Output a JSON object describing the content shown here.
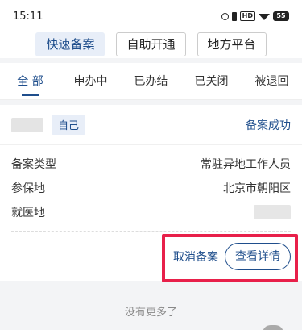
{
  "status_bar": {
    "time": "15:11",
    "battery": "55"
  },
  "top_buttons": [
    {
      "label": "快速备案",
      "active": true
    },
    {
      "label": "自助开通",
      "active": false
    },
    {
      "label": "地方平台",
      "active": false
    }
  ],
  "tabs": [
    {
      "label": "全 部",
      "active": true
    },
    {
      "label": "申办中",
      "active": false
    },
    {
      "label": "已办结",
      "active": false
    },
    {
      "label": "已关闭",
      "active": false
    },
    {
      "label": "被退回",
      "active": false
    }
  ],
  "card": {
    "self_tag": "自己",
    "status": "备案成功",
    "rows": [
      {
        "label": "备案类型",
        "value": "常驻异地工作人员"
      },
      {
        "label": "参保地",
        "value": "北京市朝阳区"
      },
      {
        "label": "就医地",
        "value": ""
      }
    ],
    "cancel_label": "取消备案",
    "detail_label": "查看详情"
  },
  "footer": {
    "no_more": "没有更多了"
  },
  "colors": {
    "accent": "#1f4e8c",
    "highlight": "#e8204a"
  }
}
